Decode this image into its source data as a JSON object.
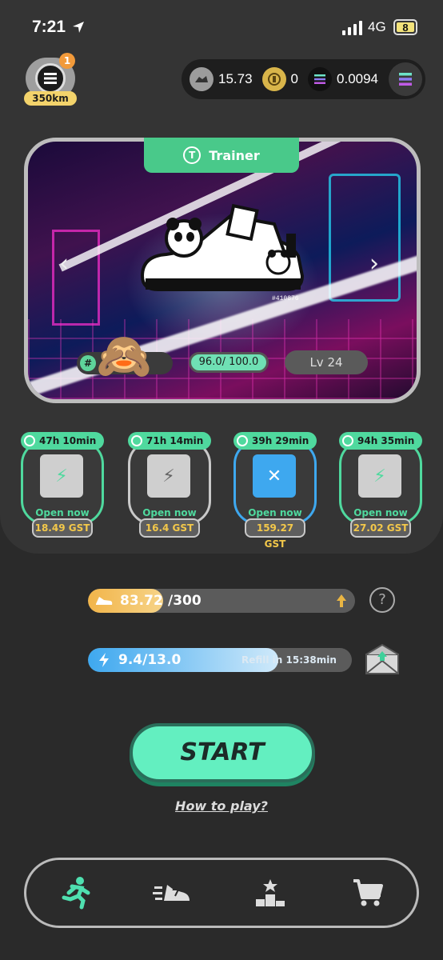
{
  "status_bar": {
    "time": "7:21",
    "network": "4G",
    "battery": "8"
  },
  "profile": {
    "badge_count": "1",
    "distance": "350km"
  },
  "balances": {
    "gst": "15.73",
    "gmt": "0",
    "sol": "0.0094"
  },
  "sneaker": {
    "type_label": "Trainer",
    "id_number": "#410876",
    "durability": "96.0/ 100.0",
    "level": "Lv 24",
    "hash_symbol": "#"
  },
  "mystery_boxes": [
    {
      "timer": "47h 10min",
      "status": "Open now",
      "price": "18.49 GST",
      "color": "#4fd99e"
    },
    {
      "timer": "71h 14min",
      "status": "Open now",
      "price": "16.4 GST",
      "color": "#c9c9c9"
    },
    {
      "timer": "39h 29min",
      "status": "Open now",
      "price": "159.27 GST",
      "color": "#3ea8ef"
    },
    {
      "timer": "94h 35min",
      "status": "Open now",
      "price": "27.02 GST",
      "color": "#4fd99e"
    }
  ],
  "energy": {
    "current": "83.72",
    "max": "/300",
    "fill_fraction": 0.28
  },
  "durability_bar": {
    "text": "9.4/13.0",
    "refill": "Refill in 15:38min",
    "fill_fraction": 0.72
  },
  "help_label": "?",
  "start_label": "START",
  "how_to_play": "How to play?",
  "colors": {
    "accent": "#63efc0",
    "gold": "#f3c84a",
    "energy": "#f2b54a",
    "blue": "#3ea8ef"
  }
}
